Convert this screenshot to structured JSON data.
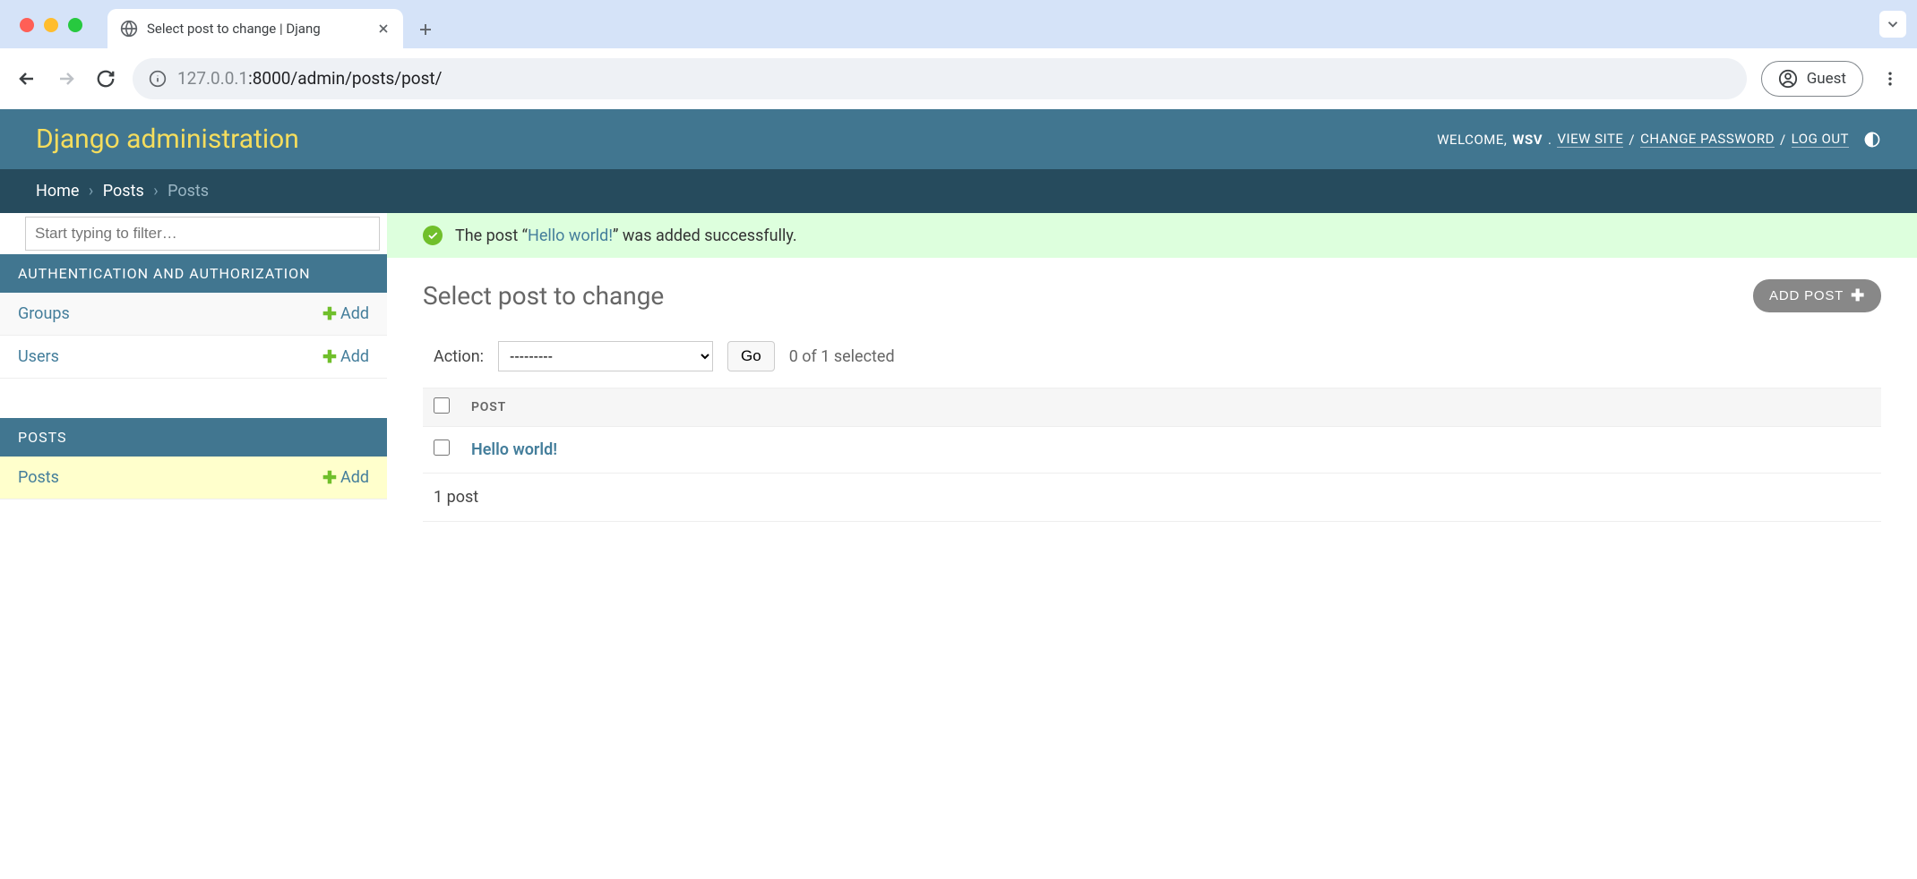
{
  "browser": {
    "tab_title": "Select post to change | Djang",
    "url_prefix": "127.0.0.1",
    "url_path": ":8000/admin/posts/post/",
    "guest_label": "Guest"
  },
  "header": {
    "site_title": "Django administration",
    "welcome": "WELCOME,",
    "username": "WSV",
    "view_site": "VIEW SITE",
    "change_password": "CHANGE PASSWORD",
    "logout": "LOG OUT"
  },
  "breadcrumb": {
    "home": "Home",
    "app": "Posts",
    "current": "Posts"
  },
  "sidebar": {
    "filter_placeholder": "Start typing to filter…",
    "apps": [
      {
        "caption": "AUTHENTICATION AND AUTHORIZATION",
        "models": [
          {
            "name": "Groups",
            "add": "Add"
          },
          {
            "name": "Users",
            "add": "Add"
          }
        ]
      },
      {
        "caption": "POSTS",
        "models": [
          {
            "name": "Posts",
            "add": "Add",
            "selected": true
          }
        ]
      }
    ]
  },
  "message": {
    "prefix": "The post “",
    "link": "Hello world!",
    "suffix": "” was added successfully."
  },
  "content": {
    "title": "Select post to change",
    "add_button": "ADD POST",
    "action_label": "Action:",
    "action_placeholder": "---------",
    "go": "Go",
    "selection_count": "0 of 1 selected",
    "column_header": "POST",
    "rows": [
      {
        "title": "Hello world!"
      }
    ],
    "paginator": "1 post"
  }
}
